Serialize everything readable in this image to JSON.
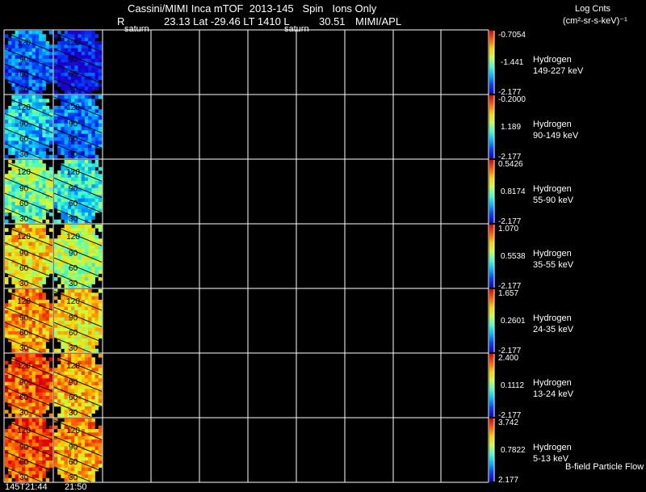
{
  "header": {
    "title": "Cassini/MIMI Inca mTOF  2013-145   Spin   Ions Only",
    "r_label": "R",
    "ephemeris": "23.13 Lat -29.46 LT 1410 L",
    "l_value": "30.51",
    "source": "MIMI/APL",
    "saturn_labels": [
      "saturn",
      "saturn"
    ]
  },
  "units": {
    "line1": "Log Cnts",
    "line2": "(cm²-sr-s-keV)⁻¹"
  },
  "time_labels": [
    "145T21:44",
    "21:50"
  ],
  "footer_note": "B-field Particle Flow",
  "colors": {
    "background": "#000000",
    "grid": "#ffffff",
    "colorbar": [
      "#1a00c8",
      "#0040ff",
      "#00b4ff",
      "#40ffd0",
      "#c8ff40",
      "#ffd000",
      "#ff6000",
      "#e00000"
    ]
  },
  "chart_data": {
    "type": "heatmap",
    "species": "Hydrogen",
    "contour_levels": [
      "120",
      "90",
      "60",
      "30"
    ],
    "panels": [
      {
        "species": "Hydrogen",
        "energy": "149-227 keV",
        "max": "-0.7054",
        "mid": "-1.441",
        "min": "-2.177",
        "level": 0.18
      },
      {
        "species": "Hydrogen",
        "energy": "90-149 keV",
        "max": "-0.2000",
        "mid": "1.189",
        "min": "-2.177",
        "level": 0.32
      },
      {
        "species": "Hydrogen",
        "energy": "55-90 keV",
        "max": "0.5426",
        "mid": "0.8174",
        "min": "-2.177",
        "level": 0.5
      },
      {
        "species": "Hydrogen",
        "energy": "35-55 keV",
        "max": "1.070",
        "mid": "0.5538",
        "min": "-2.177",
        "level": 0.68
      },
      {
        "species": "Hydrogen",
        "energy": "24-35 keV",
        "max": "1.657",
        "mid": "0.2601",
        "min": "-2.177",
        "level": 0.78
      },
      {
        "species": "Hydrogen",
        "energy": "13-24 keV",
        "max": "2.400",
        "mid": "0.1112",
        "min": "-2.177",
        "level": 0.86
      },
      {
        "species": "Hydrogen",
        "energy": "5-13 keV",
        "max": "3.742",
        "mid": "0.7822",
        "min": "2.177",
        "level": 0.88
      }
    ]
  }
}
